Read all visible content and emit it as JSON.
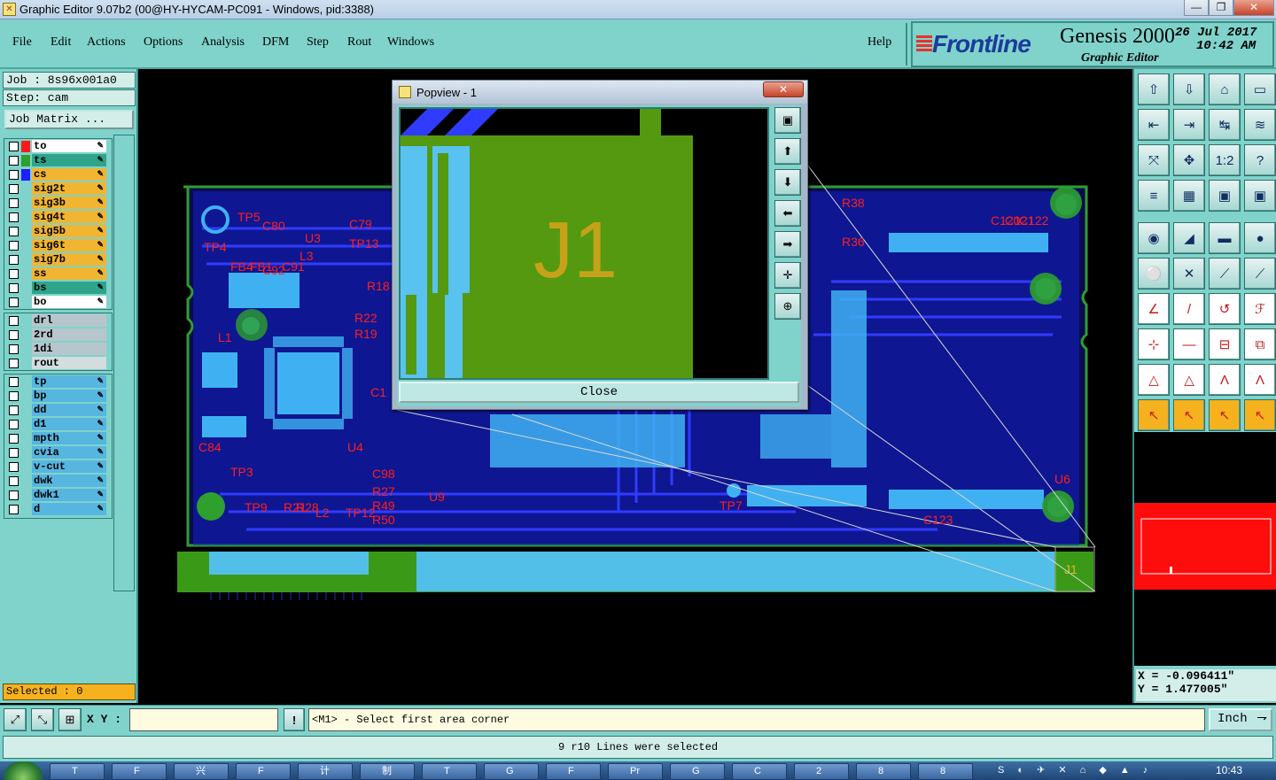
{
  "window": {
    "title": "Graphic Editor 9.07b2 (00@HY-HYCAM-PC091 - Windows, pid:3388)",
    "minimize": "—",
    "maximize": "❐",
    "close": "✕"
  },
  "menu": {
    "items": [
      "File",
      "Edit",
      "Actions",
      "Options",
      "Analysis",
      "DFM",
      "Step",
      "Rout",
      "Windows"
    ],
    "help": "Help"
  },
  "brand": {
    "logo": "Frontline",
    "product": "Genesis 2000",
    "subtitle": "Graphic Editor",
    "date": "26 Jul 2017",
    "time": "10:42 AM"
  },
  "job": {
    "job_line": "Job : 8s96x001a0",
    "step_line": "Step: cam",
    "matrix_button": "Job Matrix ..."
  },
  "layers_group1": [
    {
      "name": "to",
      "color": "#ff1a1a",
      "bg": "#ffffff"
    },
    {
      "name": "ts",
      "color": "#2da02d",
      "bg": "#2ea58a"
    },
    {
      "name": "cs",
      "color": "#1f1fff",
      "bg": "#f2b531"
    },
    {
      "name": "sig2t",
      "color": "",
      "bg": "#f2b531"
    },
    {
      "name": "sig3b",
      "color": "",
      "bg": "#f2b531"
    },
    {
      "name": "sig4t",
      "color": "",
      "bg": "#f2b531"
    },
    {
      "name": "sig5b",
      "color": "",
      "bg": "#f2b531"
    },
    {
      "name": "sig6t",
      "color": "",
      "bg": "#f2b531"
    },
    {
      "name": "sig7b",
      "color": "",
      "bg": "#f2b531"
    },
    {
      "name": "ss",
      "color": "",
      "bg": "#f2b531"
    },
    {
      "name": "bs",
      "color": "",
      "bg": "#2ea58a"
    },
    {
      "name": "bo",
      "color": "",
      "bg": "#ffffff"
    }
  ],
  "layers_group2": [
    {
      "name": "drl",
      "bg": "#b7c6cc"
    },
    {
      "name": "2rd",
      "bg": "#b7c6cc"
    },
    {
      "name": "1di",
      "bg": "#b7c6cc"
    },
    {
      "name": "rout",
      "bg": "#d3dcdf"
    }
  ],
  "layers_group3": [
    {
      "name": "tp",
      "bg": "#57b6e0"
    },
    {
      "name": "bp",
      "bg": "#57b6e0"
    },
    {
      "name": "dd",
      "bg": "#57b6e0"
    },
    {
      "name": "d1",
      "bg": "#57b6e0"
    },
    {
      "name": "mpth",
      "bg": "#57b6e0"
    },
    {
      "name": "cvia",
      "bg": "#57b6e0"
    },
    {
      "name": "v-cut",
      "bg": "#57b6e0"
    },
    {
      "name": "dwk",
      "bg": "#57b6e0"
    },
    {
      "name": "dwk1",
      "bg": "#57b6e0"
    },
    {
      "name": "d",
      "bg": "#57b6e0"
    }
  ],
  "selected": "Selected : 0",
  "popview": {
    "title": "Popview - 1",
    "label": "J1",
    "close": "Close"
  },
  "pcb_labels": [
    "TP4",
    "TP5",
    "C80",
    "U3",
    "C79",
    "TP13",
    "FB4",
    "FB1",
    "C92",
    "C91",
    "L3",
    "R18",
    "R22",
    "R19",
    "L1",
    "C84",
    "TP3",
    "U4",
    "TP9",
    "R21",
    "R28",
    "L2",
    "TP12",
    "C98",
    "R27",
    "R49",
    "R50",
    "U9",
    "C1",
    "R38",
    "R36",
    "C120",
    "C121",
    "C122",
    "U6",
    "C123",
    "TP7",
    "J1"
  ],
  "coords": {
    "x": "X = -0.096411\"",
    "y": "Y = 1.477005\""
  },
  "bottom": {
    "xy_label": "X Y :",
    "xy_value": "",
    "prompt": "<M1> - Select first area corner",
    "units": "Inch",
    "status": "9 r10 Lines were selected"
  },
  "taskbar": {
    "clock": "10:43",
    "items": [
      "T",
      "F",
      "兴",
      "F",
      "计",
      "制",
      "T",
      "G",
      "F",
      "Pr",
      "G",
      "C",
      "2",
      "8",
      "8"
    ]
  }
}
